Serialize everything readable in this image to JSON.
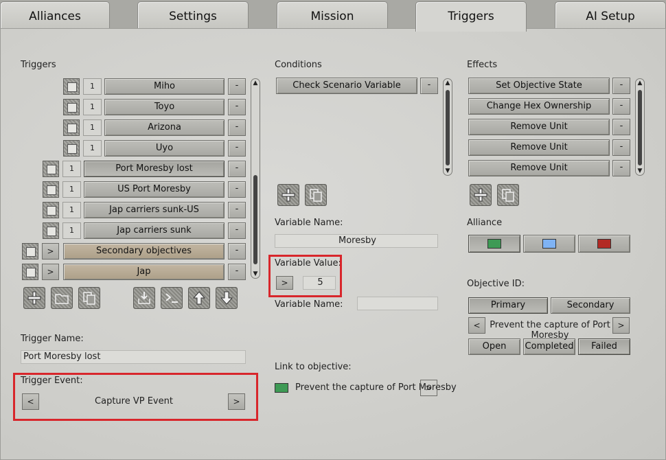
{
  "tabs": [
    "Alliances",
    "Settings",
    "Mission",
    "Triggers",
    "AI Setup"
  ],
  "active_tab": "Triggers",
  "triggers": {
    "label": "Triggers",
    "items": [
      {
        "num": "1",
        "name": "Miho",
        "style": "normal",
        "indent": 2
      },
      {
        "num": "1",
        "name": "Toyo",
        "style": "normal",
        "indent": 2
      },
      {
        "num": "1",
        "name": "Arizona",
        "style": "normal",
        "indent": 2
      },
      {
        "num": "1",
        "name": "Uyo",
        "style": "normal",
        "indent": 2
      },
      {
        "num": "1",
        "name": "Port Moresby lost",
        "style": "selected",
        "indent": 1
      },
      {
        "num": "1",
        "name": "US Port Moresby",
        "style": "normal",
        "indent": 1
      },
      {
        "num": "1",
        "name": "Jap carriers sunk-US",
        "style": "normal",
        "indent": 1
      },
      {
        "num": "1",
        "name": "Jap carriers sunk",
        "style": "normal",
        "indent": 1
      },
      {
        "num": ">",
        "name": "Secondary objectives",
        "style": "group",
        "indent": 0
      },
      {
        "num": ">",
        "name": "Jap",
        "style": "group",
        "indent": 0
      }
    ],
    "minus_label": "-",
    "trigger_name_label": "Trigger Name:",
    "trigger_name_value": "Port Moresby lost",
    "trigger_event_label": "Trigger Event:",
    "trigger_event_value": "Capture VP Event",
    "prev_label": "<",
    "next_label": ">"
  },
  "conditions": {
    "label": "Conditions",
    "items": [
      "Check Scenario Variable"
    ],
    "minus_label": "-",
    "variable_name_label": "Variable Name:",
    "variable_name_value": "Moresby",
    "variable_value_label": "Variable Value:",
    "variable_value_btn": ">",
    "variable_value": "5",
    "variable_name2_label": "Variable Name:",
    "variable_name2_value": "",
    "link_label": "Link to objective:",
    "link_value": "Prevent the capture of Port Moresby",
    "link_btn": ">"
  },
  "effects": {
    "label": "Effects",
    "items": [
      "Set Objective State",
      "Change Hex Ownership",
      "Remove Unit",
      "Remove Unit",
      "Remove Unit"
    ],
    "minus_label": "-",
    "alliance_label": "Alliance",
    "alliance_colors": [
      "#3e9a55",
      "#7fb3f4",
      "#b22a24"
    ],
    "objective_id_label": "Objective ID:",
    "primary_label": "Primary",
    "secondary_label": "Secondary",
    "objective_prev": "<",
    "objective_value": "Prevent the capture of Port Moresby",
    "objective_next": ">",
    "open_label": "Open",
    "completed_label": "Completed",
    "failed_label": "Failed"
  },
  "colors": {
    "link_swatch": "#3e9a55",
    "highlight": "#d8262b"
  },
  "scroll": {
    "up": "▲",
    "down": "▼"
  }
}
